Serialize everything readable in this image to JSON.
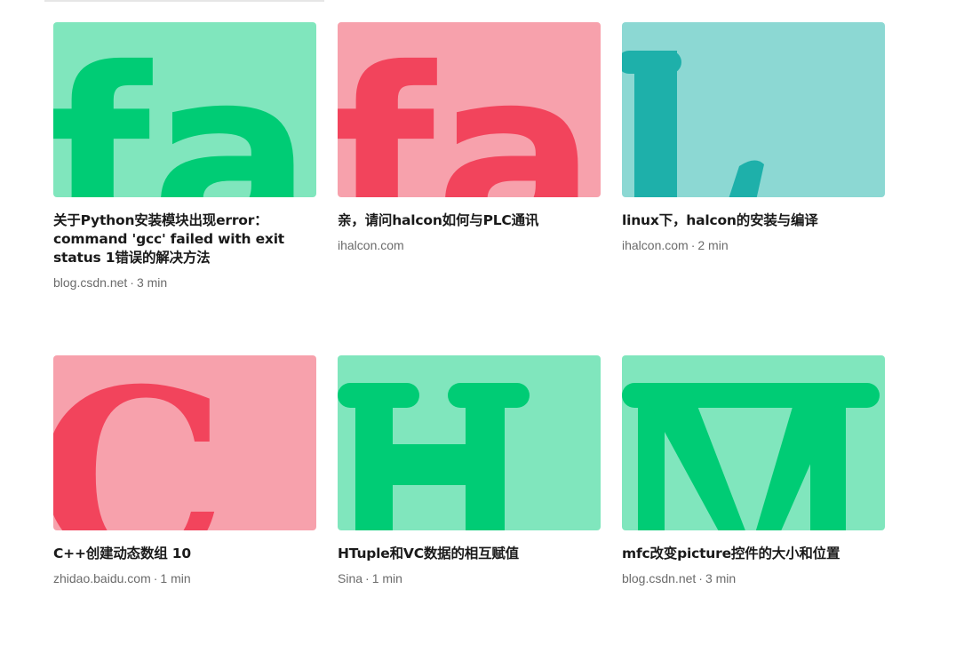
{
  "colors": {
    "green_bg": "#80e6bd",
    "green_fg": "#00cc75",
    "pink_bg": "#f7a1ac",
    "pink_fg": "#f2445c",
    "teal_bg": "#8cd8d3",
    "teal_fg": "#1eb0aa"
  },
  "cards": [
    {
      "title": "关于Python安装模块出现error：command 'gcc' failed with exit status 1错误的解决方法",
      "source": "blog.csdn.net",
      "separator": "·",
      "read_time": "3 min",
      "thumb_letters": "fa",
      "thumb_color": "green"
    },
    {
      "title": "亲，请问halcon如何与PLC通讯",
      "source": "ihalcon.com",
      "separator": "",
      "read_time": "",
      "thumb_letters": "fa",
      "thumb_color": "pink"
    },
    {
      "title": "linux下，halcon的安装与编译",
      "source": "ihalcon.com",
      "separator": "·",
      "read_time": "2 min",
      "thumb_letters": "L",
      "thumb_color": "teal"
    },
    {
      "title": "C++创建动态数组 10",
      "source": "zhidao.baidu.com",
      "separator": "·",
      "read_time": "1 min",
      "thumb_letters": "C",
      "thumb_color": "pink"
    },
    {
      "title": "HTuple和VC数据的相互赋值",
      "source": "Sina",
      "separator": "·",
      "read_time": "1 min",
      "thumb_letters": "H",
      "thumb_color": "green"
    },
    {
      "title": "mfc改变picture控件的大小和位置",
      "source": "blog.csdn.net",
      "separator": "·",
      "read_time": "3 min",
      "thumb_letters": "M",
      "thumb_color": "green"
    }
  ]
}
